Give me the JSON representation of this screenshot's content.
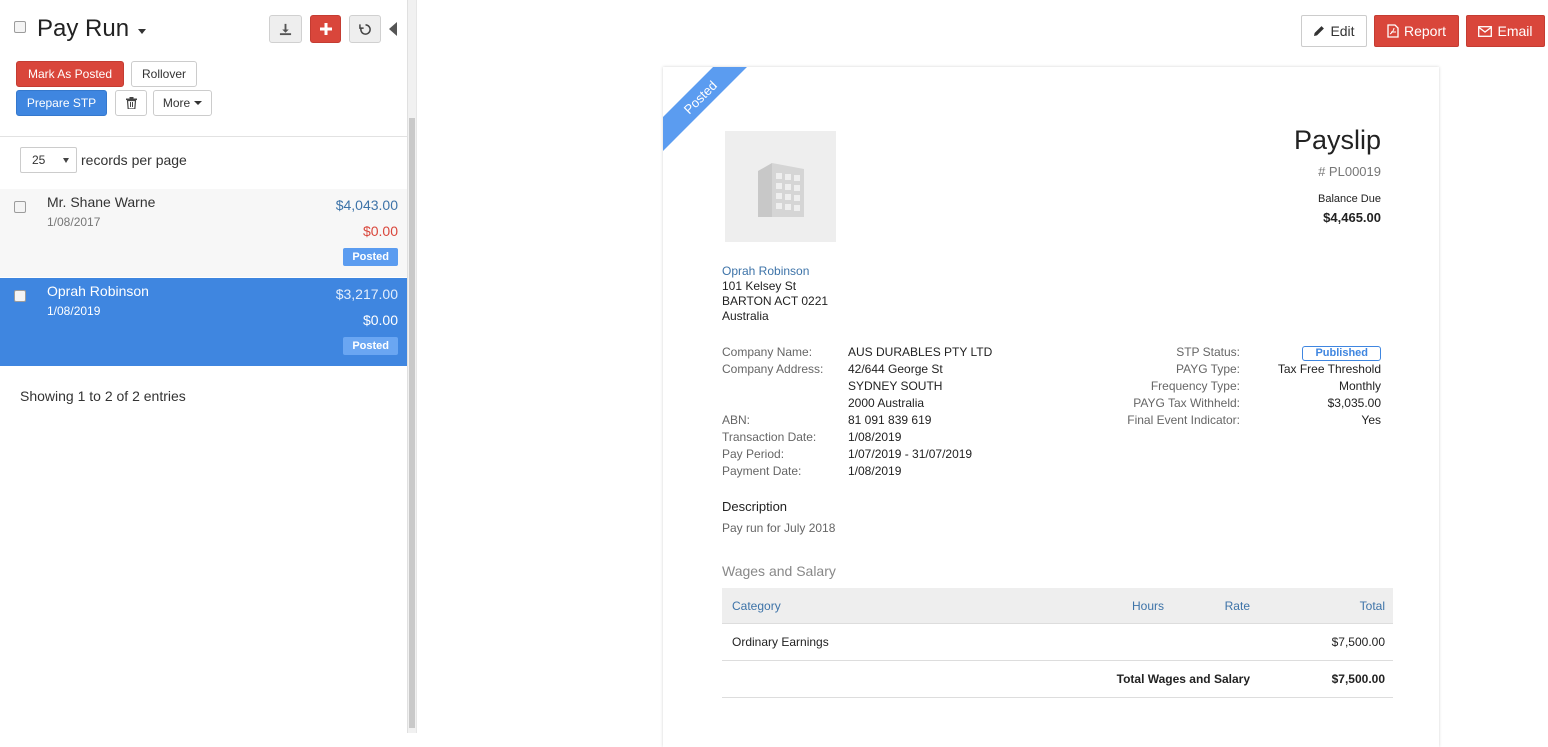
{
  "header": {
    "title": "Pay Run",
    "mark_posted_label": "Mark As Posted",
    "rollover_label": "Rollover",
    "prepare_stp_label": "Prepare STP",
    "more_label": "More"
  },
  "pagination": {
    "per_page_value": "25",
    "per_page_label": "records per page",
    "showing_text": "Showing 1 to 2 of 2 entries"
  },
  "records": [
    {
      "name": "Mr. Shane Warne",
      "date": "1/08/2017",
      "amount": "$4,043.00",
      "balance": "$0.00",
      "status": "Posted",
      "selected": false
    },
    {
      "name": "Oprah Robinson",
      "date": "1/08/2019",
      "amount": "$3,217.00",
      "balance": "$0.00",
      "status": "Posted",
      "selected": true
    }
  ],
  "toolbar": {
    "edit_label": "Edit",
    "report_label": "Report",
    "email_label": "Email"
  },
  "payslip": {
    "ribbon": "Posted",
    "title": "Payslip",
    "number": "# PL00019",
    "balance_label": "Balance Due",
    "balance_amount": "$4,465.00",
    "employee": {
      "name": "Oprah Robinson",
      "address1": "101 Kelsey St",
      "address2": "BARTON ACT 0221",
      "country": "Australia"
    },
    "company": {
      "name_label": "Company Name:",
      "name": "AUS DURABLES PTY LTD",
      "address_label": "Company Address:",
      "address1": "42/644 George St",
      "address2": "SYDNEY SOUTH",
      "address3": "2000 Australia",
      "abn_label": "ABN:",
      "abn": "81 091 839 619",
      "txn_date_label": "Transaction Date:",
      "txn_date": "1/08/2019",
      "pay_period_label": "Pay Period:",
      "pay_period": "1/07/2019 - 31/07/2019",
      "payment_date_label": "Payment Date:",
      "payment_date": "1/08/2019"
    },
    "stp": {
      "status_label": "STP Status:",
      "status": "Published",
      "payg_type_label": "PAYG Type:",
      "payg_type": "Tax Free Threshold",
      "frequency_label": "Frequency Type:",
      "frequency": "Monthly",
      "payg_withheld_label": "PAYG Tax Withheld:",
      "payg_withheld": "$3,035.00",
      "final_event_label": "Final Event Indicator:",
      "final_event": "Yes"
    },
    "description_title": "Description",
    "description": "Pay run for July 2018",
    "wages_title": "Wages and Salary",
    "wages_table": {
      "headers": {
        "category": "Category",
        "hours": "Hours",
        "rate": "Rate",
        "total": "Total"
      },
      "row1": {
        "category": "Ordinary Earnings",
        "hours": "",
        "rate": "",
        "total": "$7,500.00"
      },
      "total_label": "Total Wages and Salary",
      "total_value": "$7,500.00"
    }
  },
  "colors": {
    "primary_blue": "#3f86e0",
    "danger_red": "#d9463b",
    "link_blue": "#3d73a8"
  }
}
